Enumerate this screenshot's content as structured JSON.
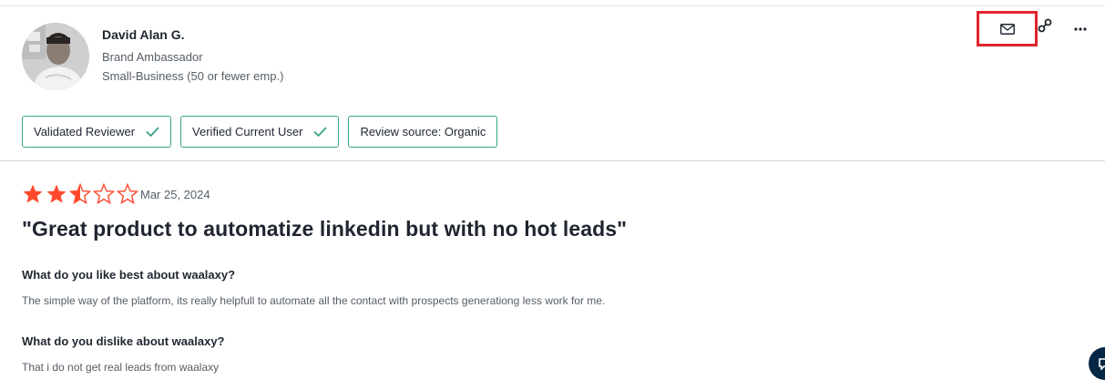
{
  "reviewer": {
    "name": "David Alan G.",
    "role": "Brand Ambassador",
    "company_size": "Small-Business (50 or fewer emp.)",
    "avatar_icon": "user-photo"
  },
  "actions": {
    "mail_icon": "mail-icon",
    "link_icon": "link-icon",
    "more_icon": "more-icon"
  },
  "badges": [
    {
      "label": "Validated Reviewer",
      "check": true
    },
    {
      "label": "Verified Current User",
      "check": true
    },
    {
      "label": "Review source: Organic",
      "check": false
    }
  ],
  "review": {
    "rating": 2.5,
    "rating_max": 5,
    "date": "Mar 25, 2024",
    "title": "\"Great product to automatize linkedin but with no hot leads\"",
    "questions": [
      {
        "q": "What do you like best about waalaxy?",
        "a": "The simple way of the platform, its really helpfull to automate all the contact with prospects generationg less work for me."
      },
      {
        "q": "What do you dislike about waalaxy?",
        "a": "That i do not get real leads from waalaxy"
      }
    ]
  },
  "colors": {
    "star": "#ff492c",
    "badge_border": "#36a58a",
    "highlight": "#e0262b",
    "chat_bg": "#062846"
  }
}
